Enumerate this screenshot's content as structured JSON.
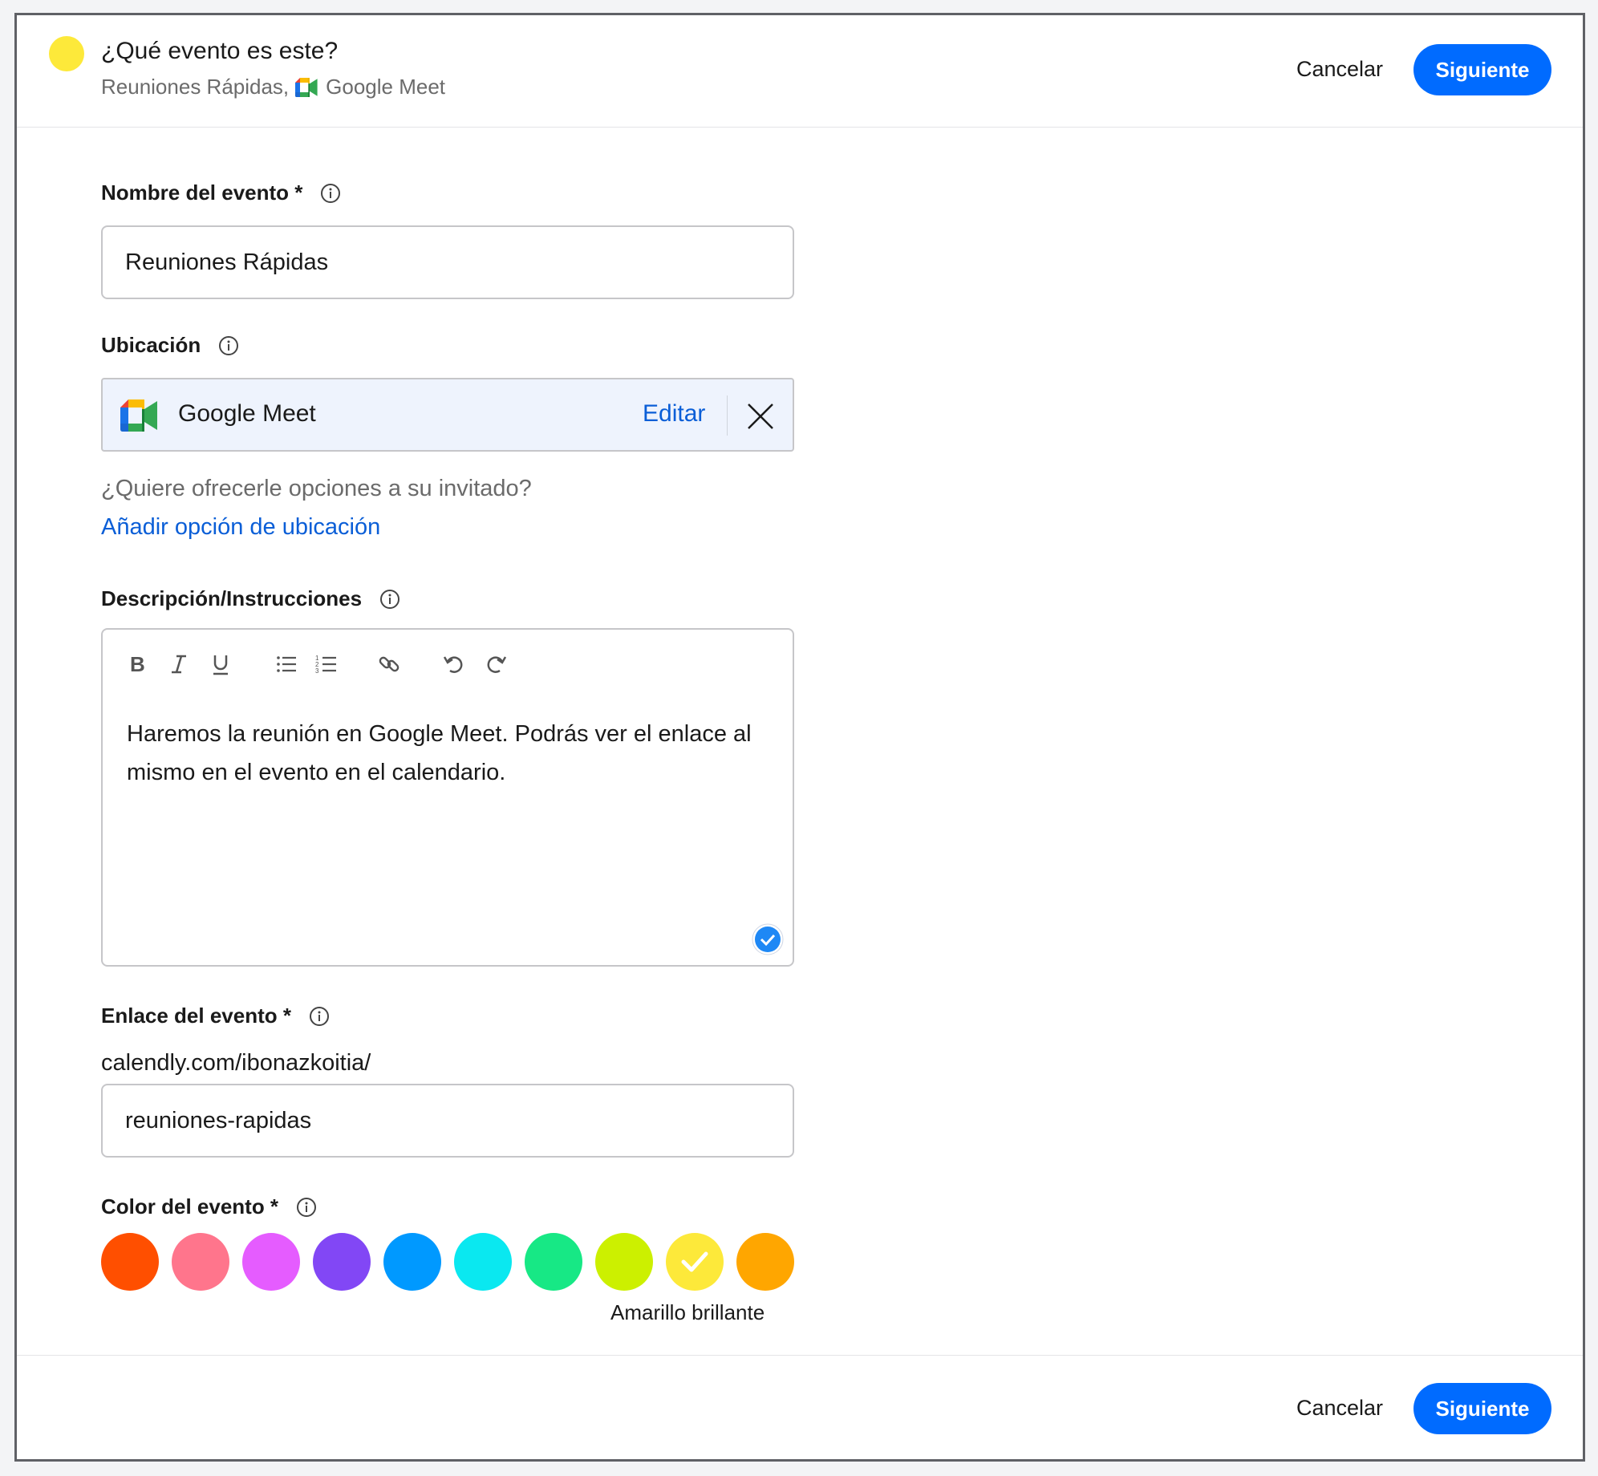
{
  "colors": {
    "accent": "#006bff",
    "link": "#0a5ed7",
    "selected_event_color": "#fde93a"
  },
  "header": {
    "title": "¿Qué evento es este?",
    "subtitle_name": "Reuniones Rápidas,",
    "subtitle_location": "Google Meet",
    "cancel_label": "Cancelar",
    "next_label": "Siguiente"
  },
  "form": {
    "event_name": {
      "label": "Nombre del evento *",
      "value": "Reuniones Rápidas",
      "icon": "info-icon"
    },
    "location": {
      "label": "Ubicación",
      "provider": "Google Meet",
      "edit_label": "Editar",
      "icon": "google-meet-icon",
      "hint": "¿Quiere ofrecerle opciones a su invitado?",
      "add_option": "Añadir opción de ubicación"
    },
    "description": {
      "label": "Descripción/Instrucciones",
      "toolbar": [
        "bold-icon",
        "italic-icon",
        "underline-icon",
        "bulleted-list-icon",
        "numbered-list-icon",
        "link-icon",
        "undo-icon",
        "redo-icon"
      ],
      "text": "Haremos la reunión en Google Meet. Podrás ver el enlace al mismo en el evento en el calendario."
    },
    "event_link": {
      "label": "Enlace del evento *",
      "prefix": "calendly.com/ibonazkoitia/",
      "value": "reuniones-rapidas"
    },
    "event_color": {
      "label": "Color del evento *",
      "swatches": [
        "#ff4f00",
        "#ff758c",
        "#e55cff",
        "#8247f5",
        "#0099ff",
        "#0ae8f0",
        "#17e885",
        "#ccf000",
        "#fde93a",
        "#ffa600"
      ],
      "selected_index": 8,
      "selected_name": "Amarillo brillante"
    }
  },
  "footer": {
    "cancel_label": "Cancelar",
    "next_label": "Siguiente"
  }
}
